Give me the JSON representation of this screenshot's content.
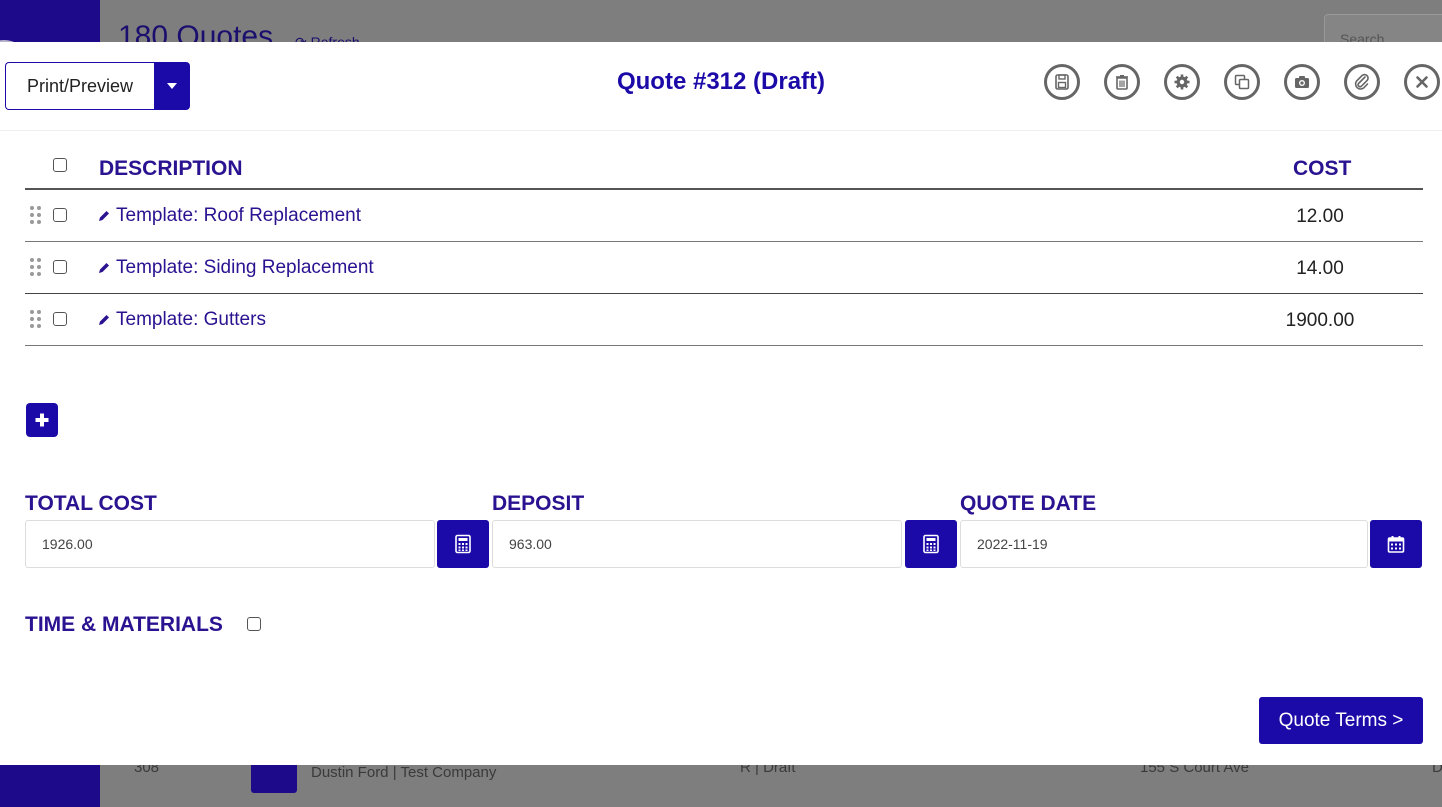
{
  "background": {
    "title": "180 Quotes",
    "refresh_label": "⟳ Refresh",
    "search_placeholder": "Search",
    "row": {
      "number": "308",
      "customer": "Dustin Ford | Test Company",
      "status": "R | Draft",
      "address": "155 S Court Ave",
      "extra": "D"
    }
  },
  "modal": {
    "title": "Quote #312 (Draft)",
    "print_label": "Print/Preview",
    "header_icons": [
      "save-icon",
      "trash-icon",
      "gear-icon",
      "copy-icon",
      "camera-icon",
      "paperclip-icon",
      "close-icon"
    ],
    "table": {
      "columns": {
        "description": "DESCRIPTION",
        "cost": "COST"
      },
      "rows": [
        {
          "description": "Template: Roof Replacement",
          "cost": "12.00"
        },
        {
          "description": "Template: Siding Replacement",
          "cost": "14.00"
        },
        {
          "description": "Template: Gutters",
          "cost": "1900.00"
        }
      ]
    },
    "fields": {
      "total_cost": {
        "label": "TOTAL COST",
        "value": "1926.00"
      },
      "deposit": {
        "label": "DEPOSIT",
        "value": "963.00"
      },
      "quote_date": {
        "label": "QUOTE DATE",
        "value": "2022-11-19"
      }
    },
    "time_materials_label": "TIME & MATERIALS",
    "quote_terms_label": "Quote Terms >"
  },
  "colors": {
    "accent": "#1c0aa8",
    "heading": "#2a1290",
    "icon_gray": "#666666"
  }
}
